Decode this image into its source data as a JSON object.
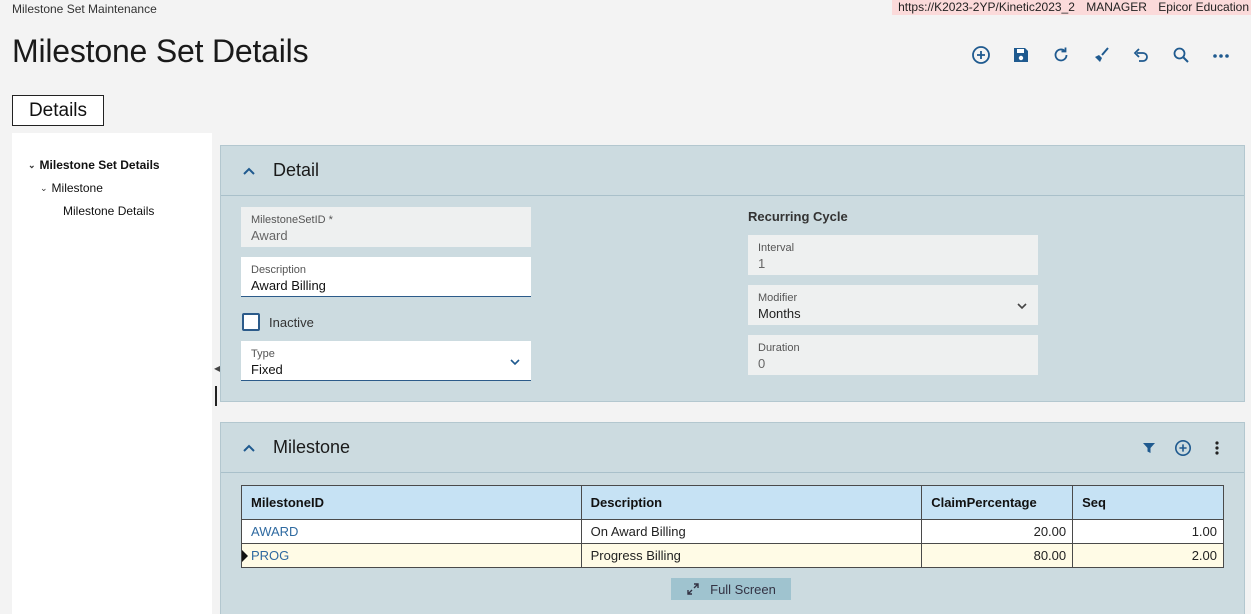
{
  "app": {
    "title": "Milestone Set Maintenance",
    "env": {
      "url": "https://K2023-2YP/Kinetic2023_2",
      "user": "MANAGER",
      "company": "Epicor Education"
    }
  },
  "page": {
    "title": "Milestone Set Details",
    "tab_label": "Details"
  },
  "toolbar": {
    "icons": [
      "add-new-icon",
      "save-icon",
      "refresh-icon",
      "clear-icon",
      "undo-icon",
      "search-icon",
      "more-options-icon"
    ]
  },
  "tree": {
    "items": [
      {
        "label": "Milestone Set Details"
      },
      {
        "label": "Milestone"
      },
      {
        "label": "Milestone Details"
      }
    ]
  },
  "detail": {
    "title": "Detail",
    "milestone_set_id": {
      "label": "MilestoneSetID *",
      "value": "Award"
    },
    "description": {
      "label": "Description",
      "value": "Award Billing"
    },
    "inactive": {
      "label": "Inactive",
      "checked": false
    },
    "type": {
      "label": "Type",
      "value": "Fixed"
    },
    "recurring": {
      "title": "Recurring Cycle",
      "interval": {
        "label": "Interval",
        "value": "1"
      },
      "modifier": {
        "label": "Modifier",
        "value": "Months"
      },
      "duration": {
        "label": "Duration",
        "value": "0"
      }
    }
  },
  "milestone": {
    "title": "Milestone",
    "columns": [
      "MilestoneID",
      "Description",
      "ClaimPercentage",
      "Seq"
    ],
    "rows": [
      {
        "id": "AWARD",
        "description": "On Award Billing",
        "claim": "20.00",
        "seq": "1.00"
      },
      {
        "id": "PROG",
        "description": "Progress Billing",
        "claim": "80.00",
        "seq": "2.00"
      }
    ],
    "fullscreen_label": "Full Screen"
  },
  "colors": {
    "accent": "#2c5b8a",
    "panel_bg": "#ccdbe0",
    "grid_header": "#c6e2f4",
    "env_banner": "#fbdada"
  }
}
